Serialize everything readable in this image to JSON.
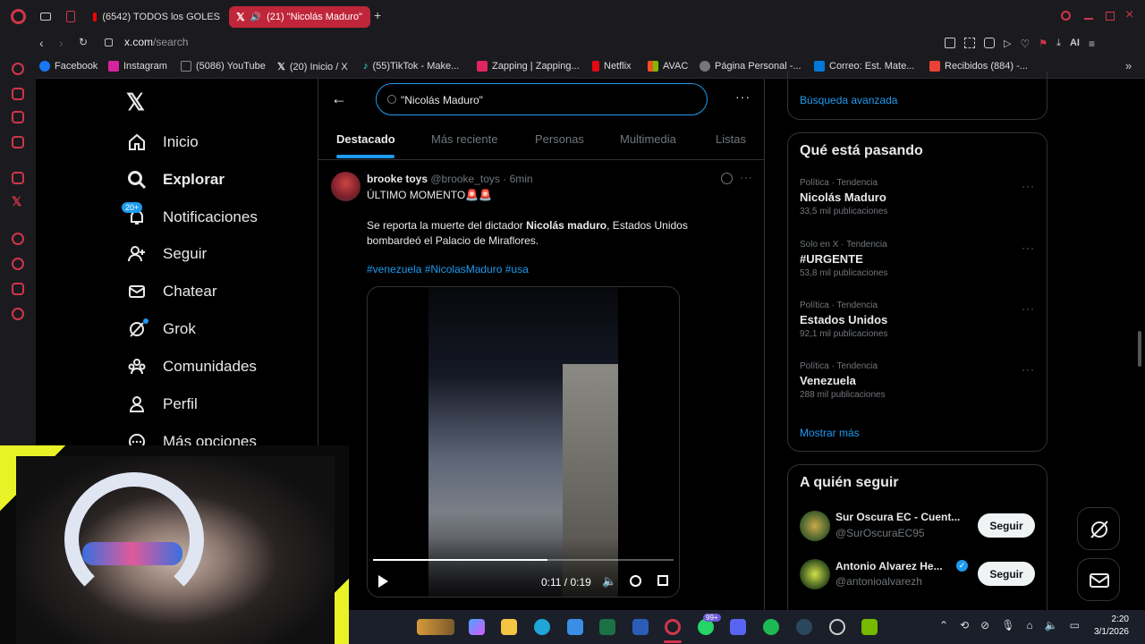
{
  "browser": {
    "tabs": [
      {
        "label": "(6542) TODOS los GOLES",
        "icon": "youtube-icon"
      },
      {
        "label": "(21) \"Nicolás Maduro\"",
        "icon": "x-logo-icon"
      }
    ],
    "url_host": "x.com",
    "url_path": "/search",
    "aria_label": "AI",
    "bookmarks": [
      {
        "label": "Facebook",
        "color": "#1877f2"
      },
      {
        "label": "Instagram",
        "color": "#d6249f"
      },
      {
        "label": "(5086) YouTube",
        "color": "#888888"
      },
      {
        "label": "(20) Inicio / X",
        "color": "#ffffff"
      },
      {
        "label": "(55)TikTok - Make...",
        "color": "#25f4ee"
      },
      {
        "label": "Zapping | Zapping...",
        "color": "#e0245e"
      },
      {
        "label": "Netflix",
        "color": "#e50914"
      },
      {
        "label": "AVAC",
        "color": "#f4b400"
      },
      {
        "label": "Página Personal -...",
        "color": "#888888"
      },
      {
        "label": "Correo: Est. Mate...",
        "color": "#0078d4"
      },
      {
        "label": "Recibidos (884) -...",
        "color": "#ea4335"
      }
    ]
  },
  "nav": {
    "items": [
      {
        "label": "Inicio",
        "icon": "home-icon"
      },
      {
        "label": "Explorar",
        "icon": "search-icon"
      },
      {
        "label": "Notificaciones",
        "icon": "bell-icon",
        "badge": "20+"
      },
      {
        "label": "Seguir",
        "icon": "add-person-icon"
      },
      {
        "label": "Chatear",
        "icon": "mail-icon"
      },
      {
        "label": "Grok",
        "icon": "grok-icon"
      },
      {
        "label": "Comunidades",
        "icon": "communities-icon"
      },
      {
        "label": "Perfil",
        "icon": "profile-icon"
      },
      {
        "label": "Más opciones",
        "icon": "more-icon"
      }
    ]
  },
  "search": {
    "query": "\"Nicolás Maduro\"",
    "tabs": [
      "Destacado",
      "Más reciente",
      "Personas",
      "Multimedia",
      "Listas"
    ],
    "active_tab": "Destacado"
  },
  "tweet": {
    "author": "brooke toys",
    "handle": "@brooke_toys",
    "time": "· 6min",
    "line1": "ÚLTIMO MOMENTO🚨🚨",
    "body_pre": "Se reporta la muerte del dictador ",
    "body_bold": "Nicolás maduro",
    "body_post": ", Estados Unidos bombardeó el Palacio de Miraflores.",
    "hashtags": "#venezuela #NicolasMaduro #usa",
    "video": {
      "time": "0:11 / 0:19",
      "progress": 0.58
    }
  },
  "right": {
    "advanced_search": "Búsqueda avanzada",
    "trends_title": "Qué está pasando",
    "trends": [
      {
        "context": "Política · Tendencia",
        "name": "Nicolás Maduro",
        "count": "33,5 mil publicaciones"
      },
      {
        "context": "Solo en X · Tendencia",
        "name": "#URGENTE",
        "count": "53,8 mil publicaciones"
      },
      {
        "context": "Política · Tendencia",
        "name": "Estados Unidos",
        "count": "92,1 mil publicaciones"
      },
      {
        "context": "Política · Tendencia",
        "name": "Venezuela",
        "count": "288 mil publicaciones"
      }
    ],
    "show_more": "Mostrar más",
    "follow_title": "A quién seguir",
    "follow": [
      {
        "name": "Sur Oscura EC - Cuent...",
        "handle": "@SurOscuraEC95",
        "button": "Seguir",
        "verified": false
      },
      {
        "name": "Antonio Alvarez He...",
        "handle": "@antonioalvarezh",
        "button": "Seguir",
        "verified": true
      }
    ]
  },
  "taskbar": {
    "time": "2:20",
    "date": "3/1/2026",
    "notif_badge": "99+"
  },
  "colors": {
    "x_blue": "#1d9bf0",
    "opera_red": "#c0263a",
    "bg": "#000000"
  }
}
